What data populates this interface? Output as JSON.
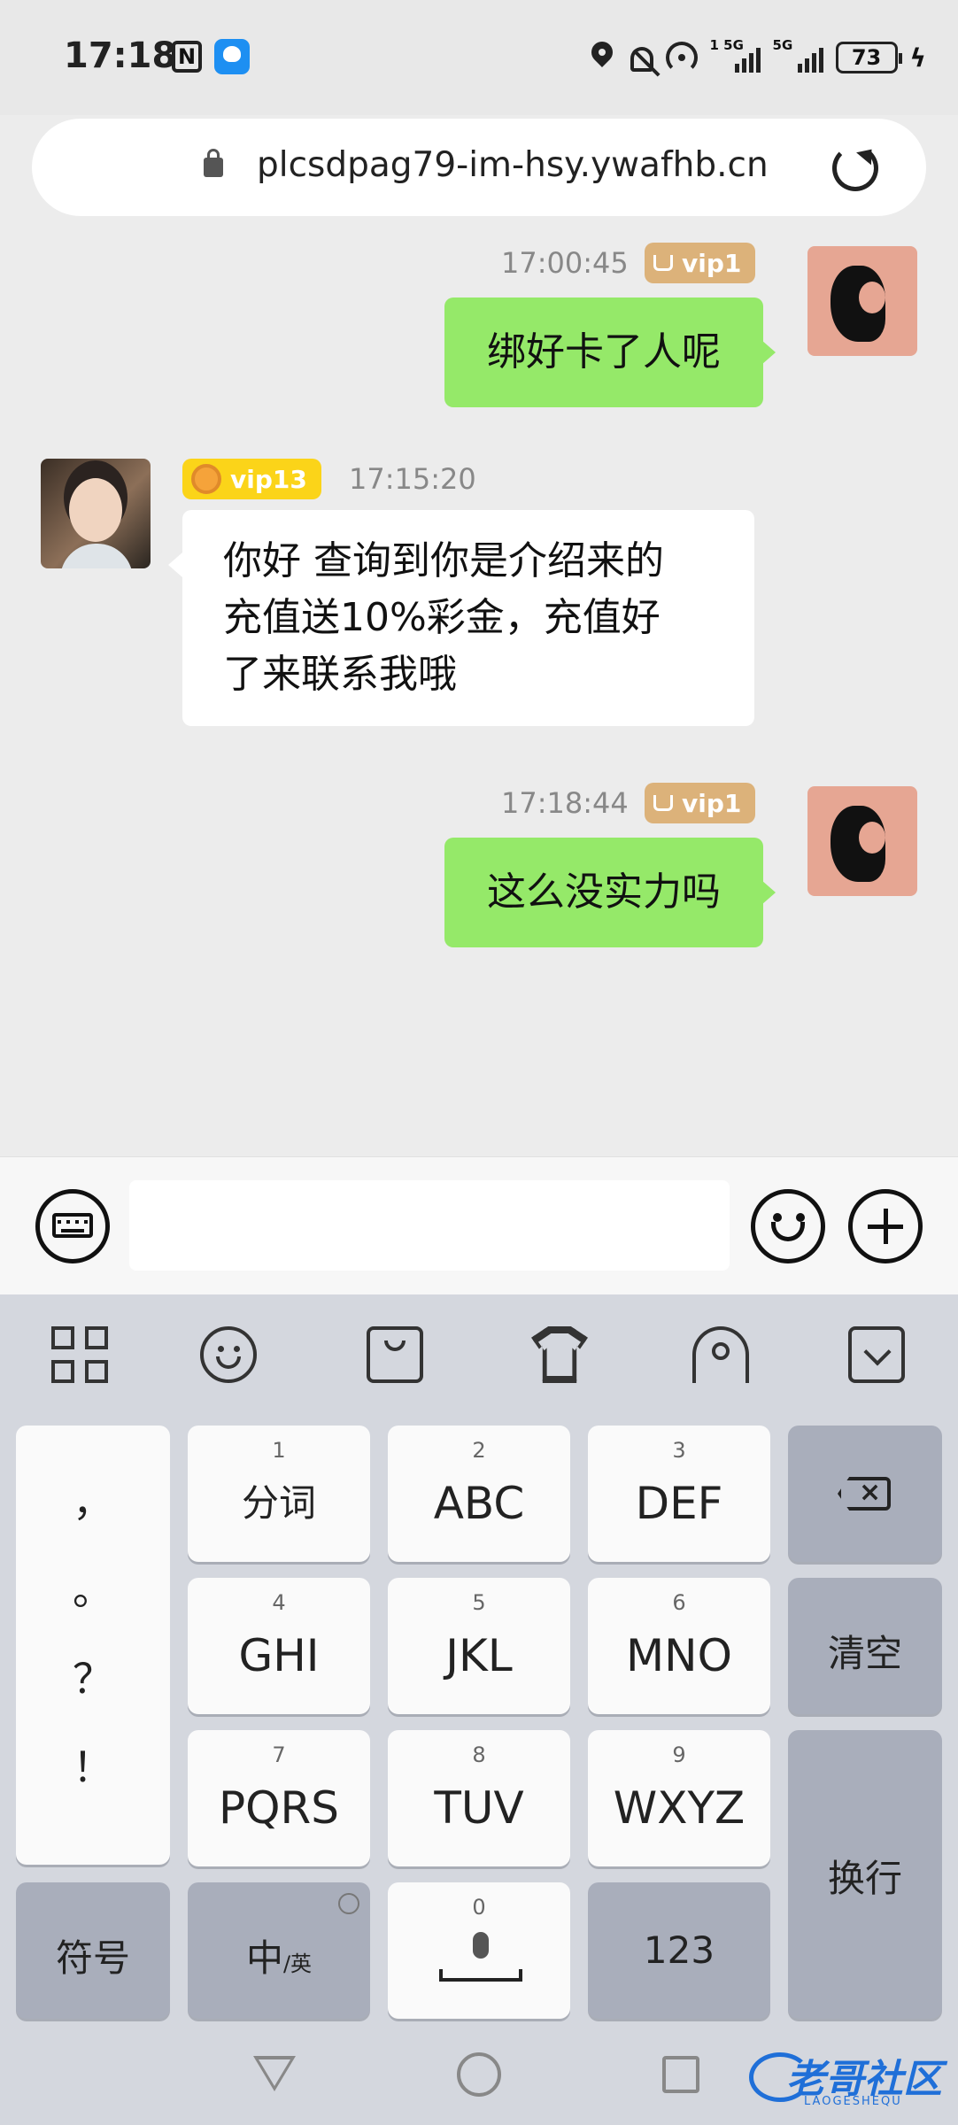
{
  "status_bar": {
    "time": "17:18",
    "network_labels": [
      "1 5G",
      "5G"
    ],
    "battery": "73"
  },
  "browser": {
    "url": "plcsdpag79-im-hsy.ywafhb.cn"
  },
  "messages": [
    {
      "sender": "me",
      "time": "17:00:45",
      "vip": "vip1",
      "text": "绑好卡了人呢"
    },
    {
      "sender": "agent",
      "time": "17:15:20",
      "vip": "vip13",
      "lines": [
        "你好 查询到你是介绍来的",
        "充值送10%彩金，充值好",
        "了来联系我哦"
      ]
    },
    {
      "sender": "me",
      "time": "17:18:44",
      "vip": "vip1",
      "text": "这么没实力吗"
    }
  ],
  "input": {
    "value": ""
  },
  "keyboard": {
    "punctuation": [
      "，",
      "。",
      "？",
      "！"
    ],
    "keys": [
      {
        "num": "1",
        "label": "分词"
      },
      {
        "num": "2",
        "label": "ABC"
      },
      {
        "num": "3",
        "label": "DEF"
      },
      {
        "num": "4",
        "label": "GHI"
      },
      {
        "num": "5",
        "label": "JKL"
      },
      {
        "num": "6",
        "label": "MNO"
      },
      {
        "num": "7",
        "label": "PQRS"
      },
      {
        "num": "8",
        "label": "TUV"
      },
      {
        "num": "9",
        "label": "WXYZ"
      }
    ],
    "clear": "清空",
    "enter": "换行",
    "symbols": "符号",
    "lang_main": "中",
    "lang_sub": "/英",
    "space_num": "0",
    "numbers": "123"
  },
  "watermark": {
    "text": "老哥社区",
    "sub": "LAOGESHEQU"
  },
  "colors": {
    "my_bubble": "#95e969",
    "agent_bubble": "#ffffff",
    "vip_gold": "#dcb27a",
    "vip_yellow": "#fbd419"
  }
}
